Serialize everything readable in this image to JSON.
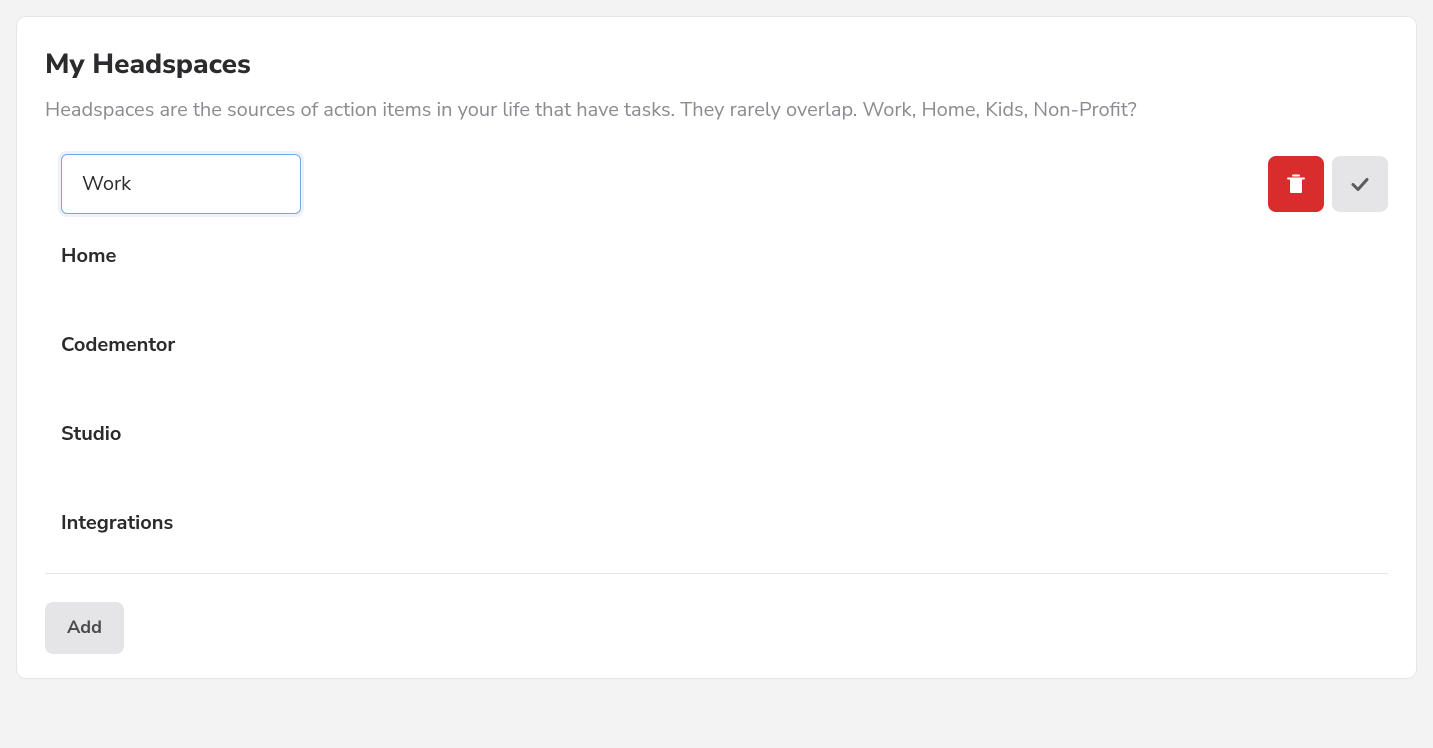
{
  "header": {
    "title": "My Headspaces",
    "subtitle": "Headspaces are the sources of action items in your life that have tasks. They rarely overlap. Work, Home, Kids, Non-Profit?"
  },
  "editing_item": {
    "value": "Work"
  },
  "items": [
    {
      "label": "Home"
    },
    {
      "label": "Codementor"
    },
    {
      "label": "Studio"
    },
    {
      "label": "Integrations"
    }
  ],
  "actions": {
    "add_label": "Add"
  },
  "colors": {
    "danger": "#d92c2c",
    "surface": "#ffffff",
    "muted": "#e5e5e7",
    "text_muted": "#8a8a90",
    "border_focus": "#7aa7e3"
  }
}
